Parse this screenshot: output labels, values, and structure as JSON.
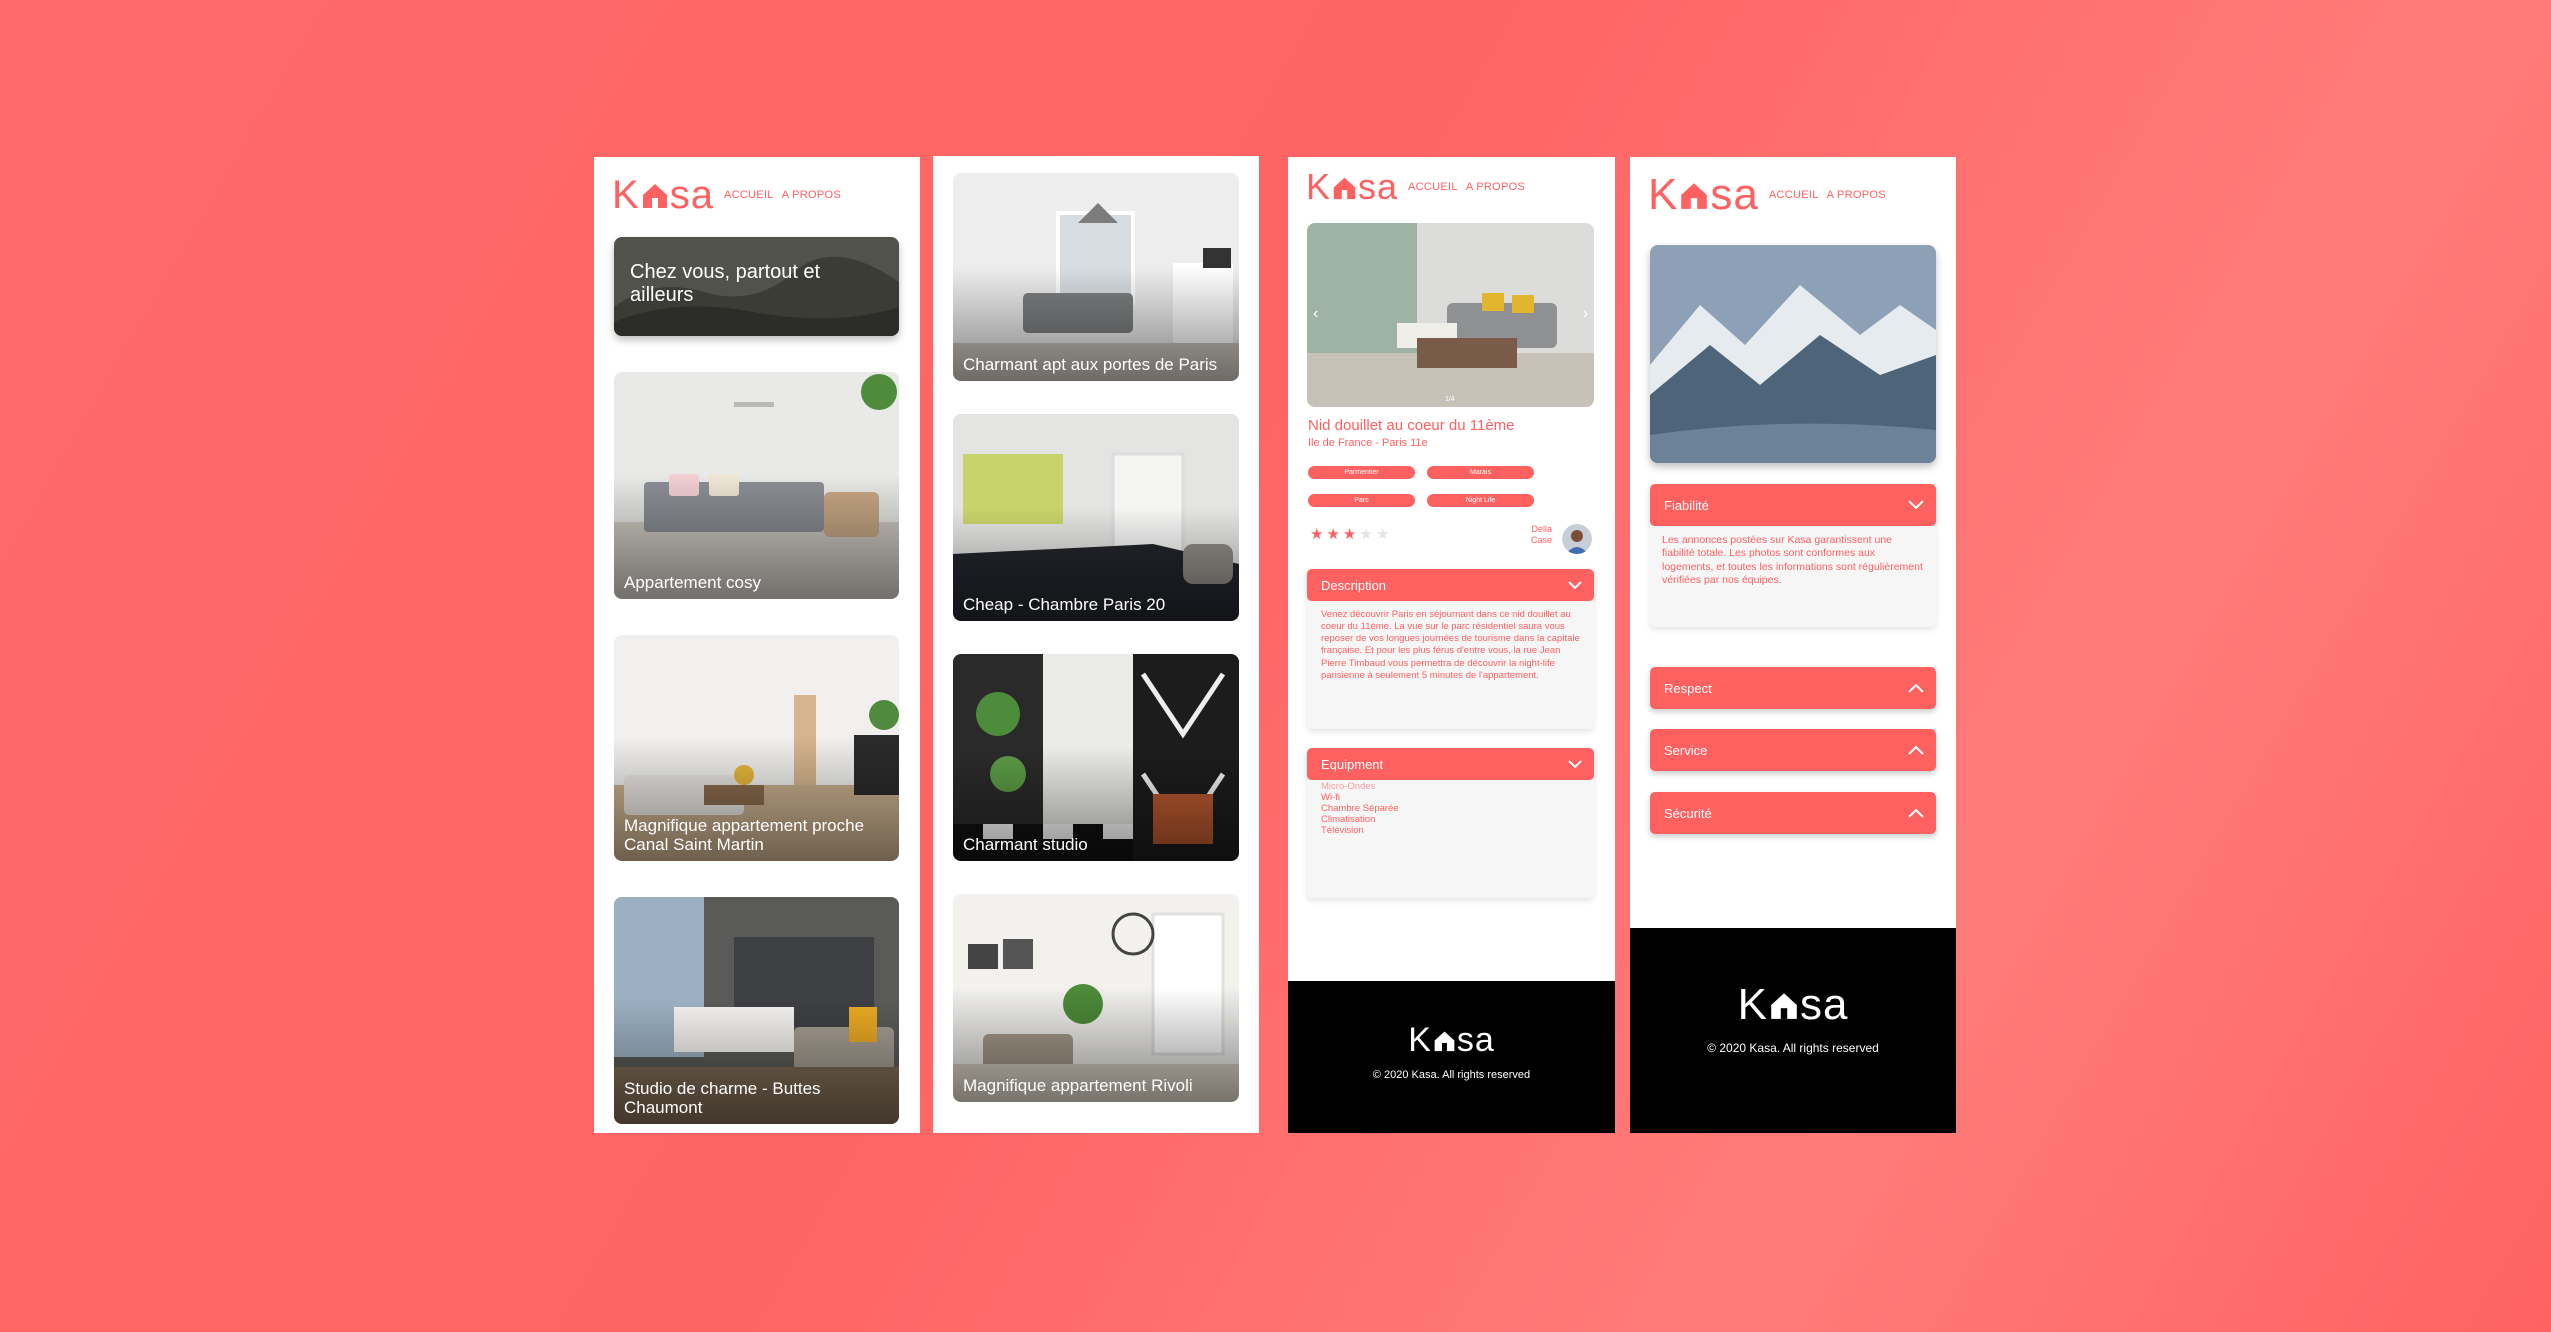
{
  "brand": {
    "logo_k": "K",
    "logo_sa": "sa",
    "accent": "#FF6060",
    "footer_bg": "#000000"
  },
  "nav": {
    "home": "ACCUEIL",
    "about": "A PROPOS"
  },
  "home": {
    "banner_title": "Chez vous, partout et ailleurs",
    "listings_col1": [
      "Appartement cosy",
      "Magnifique appartement proche Canal Saint Martin",
      "Studio de charme - Buttes Chaumont"
    ],
    "listings_col2": [
      "Charmant apt aux portes de Paris",
      "Cheap - Chambre Paris 20",
      "Charmant studio",
      "Magnifique appartement Rivoli"
    ]
  },
  "detail": {
    "slide_counter": "1/4",
    "title": "Nid douillet au coeur du 11ème",
    "location": "Ile de France - Paris 11e",
    "tags": [
      "Parmentier",
      "Marais",
      "Parc",
      "Night Life"
    ],
    "rating": 3,
    "rating_max": 5,
    "host_first": "Della",
    "host_last": "Case",
    "description_label": "Description",
    "description_text": "Venez découvrir Paris en séjournant dans ce nid douillet au coeur du 11ème. La vue sur le parc résidentiel saura vous reposer de vos longues journées de tourisme dans la capitale française. Et pour les plus férus d'entre vous, la rue Jean Pierre Timbaud vous permettra de découvrir la night-life parisienne à seulement 5 minutes de l'appartement.",
    "equipment_label": "Equipment",
    "equipment": [
      "Micro-Ondes",
      "Wi-fi",
      "Chambre Séparée",
      "Climatisation",
      "Télévision"
    ]
  },
  "about": {
    "sections": [
      {
        "label": "Fiabilité",
        "open": true,
        "text": "Les annonces postées sur Kasa garantissent une fiabilité totale. Les photos sont conformes aux logements, et toutes les informations sont régulièrement vérifiées par nos équipes."
      },
      {
        "label": "Respect",
        "open": false
      },
      {
        "label": "Service",
        "open": false
      },
      {
        "label": "Sécurité",
        "open": false
      }
    ]
  },
  "footer": {
    "copyright": "© 2020 Kasa. All rights reserved"
  }
}
